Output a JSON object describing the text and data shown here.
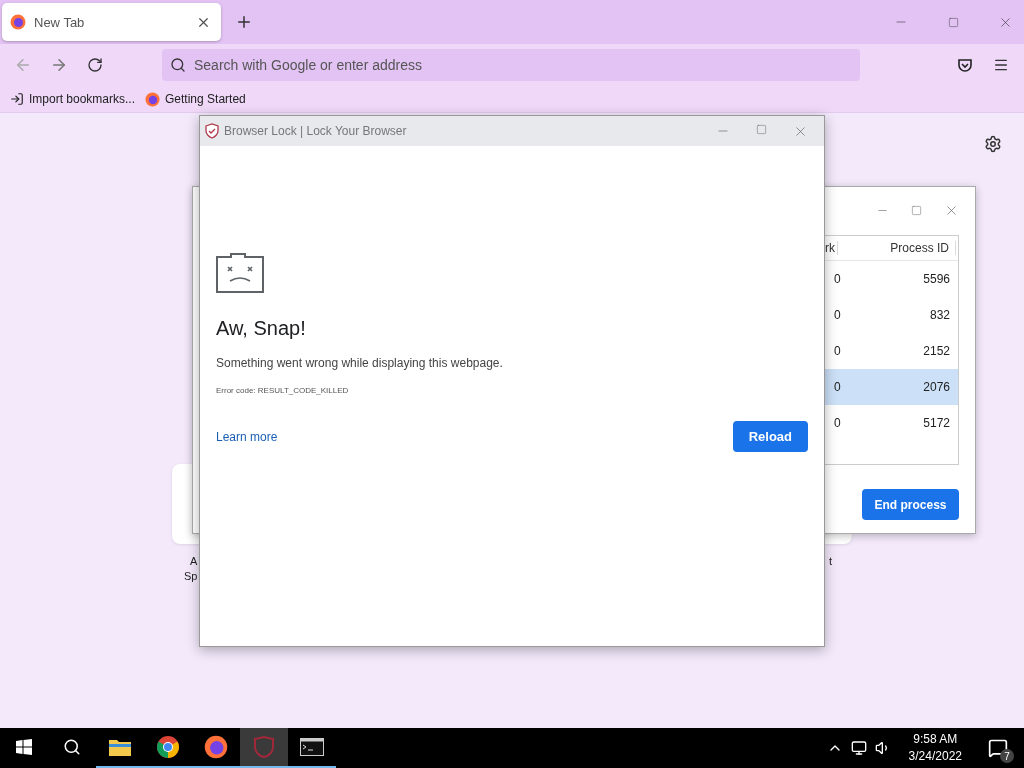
{
  "browser": {
    "tabs": [
      {
        "label": "New Tab",
        "selected": true
      }
    ],
    "address": {
      "placeholder": "Search with Google or enter address"
    },
    "bookmarks": [
      {
        "kind": "import",
        "label": "Import bookmarks..."
      },
      {
        "kind": "site",
        "label": "Getting Started"
      }
    ],
    "tiles": [
      {
        "lines": [
          "A",
          "Sp"
        ]
      },
      {
        "lines": [
          "t"
        ]
      }
    ]
  },
  "task_manager": {
    "columns": [
      "rk",
      "Process ID"
    ],
    "rows": [
      {
        "column_1": "0",
        "process_id": "5596",
        "selected": false
      },
      {
        "column_1": "0",
        "process_id": "832",
        "selected": false
      },
      {
        "column_1": "0",
        "process_id": "2152",
        "selected": false
      },
      {
        "column_1": "0",
        "process_id": "2076",
        "selected": true
      },
      {
        "column_1": "0",
        "process_id": "5172",
        "selected": false
      }
    ],
    "button": "End process"
  },
  "dialog": {
    "title": "Browser Lock | Lock Your Browser",
    "heading": "Aw, Snap!",
    "message": "Something went wrong while displaying this webpage.",
    "error_code": "Error code: RESULT_CODE_KILLED",
    "link": "Learn more",
    "button": "Reload"
  },
  "taskbar": {
    "apps": [
      {
        "kind": "explorer",
        "running": true,
        "active": false
      },
      {
        "kind": "chrome",
        "running": true,
        "active": false
      },
      {
        "kind": "firefox",
        "running": true,
        "active": false
      },
      {
        "kind": "lock",
        "running": true,
        "active": true
      },
      {
        "kind": "terminal",
        "running": true,
        "active": false
      }
    ],
    "time": "9:58 AM",
    "date": "3/24/2022",
    "notifications": "7"
  }
}
